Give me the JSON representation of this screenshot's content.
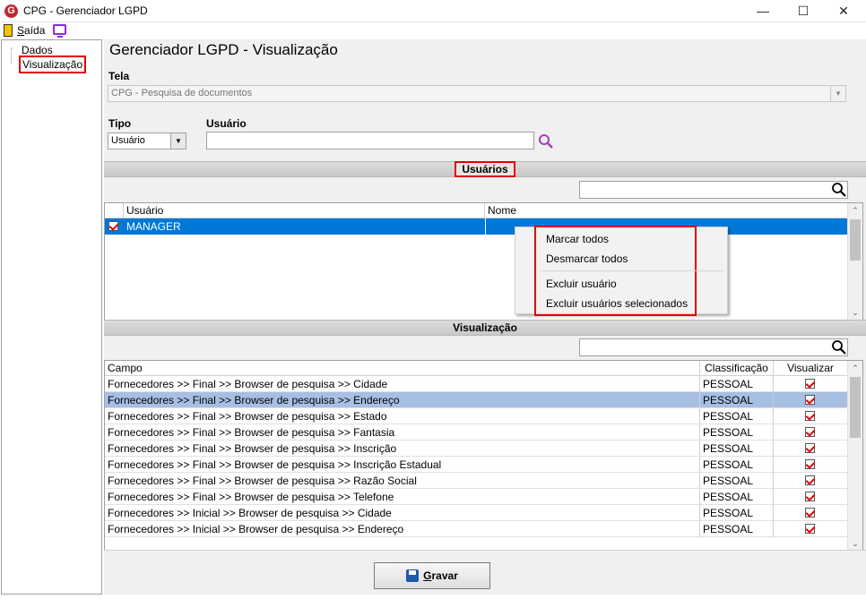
{
  "window": {
    "title": "CPG - Gerenciador LGPD",
    "logo": "G"
  },
  "menu": {
    "exit_first": "S",
    "exit_rest": "aída"
  },
  "sidebar": {
    "items": [
      "Dados",
      "Visualização"
    ]
  },
  "main": {
    "title": "Gerenciador LGPD - Visualização",
    "tela_label": "Tela",
    "tela_value": "CPG - Pesquisa de documentos",
    "tipo_label": "Tipo",
    "tipo_value": "Usuário",
    "usuario_label": "Usuário",
    "usuario_value": ""
  },
  "users_section": {
    "title": "Usuários",
    "search_value": "",
    "columns": [
      "Usuário",
      "Nome"
    ],
    "rows": [
      {
        "checked": true,
        "usuario": "MANAGER",
        "nome": ""
      }
    ]
  },
  "context_menu": {
    "items": [
      "Marcar todos",
      "Desmarcar todos",
      "Excluir usuário",
      "Excluir usuários selecionados"
    ]
  },
  "view_section": {
    "title": "Visualização",
    "search_value": "",
    "columns": [
      "Campo",
      "Classificação",
      "Visualizar"
    ],
    "rows": [
      {
        "campo": "Fornecedores >> Final >> Browser de pesquisa >> Cidade",
        "classificacao": "PESSOAL",
        "visualizar": true
      },
      {
        "campo": "Fornecedores >> Final >> Browser de pesquisa >> Endereço",
        "classificacao": "PESSOAL",
        "visualizar": true
      },
      {
        "campo": "Fornecedores >> Final >> Browser de pesquisa >> Estado",
        "classificacao": "PESSOAL",
        "visualizar": true
      },
      {
        "campo": "Fornecedores >> Final >> Browser de pesquisa >> Fantasia",
        "classificacao": "PESSOAL",
        "visualizar": true
      },
      {
        "campo": "Fornecedores >> Final >> Browser de pesquisa >> Inscrição",
        "classificacao": "PESSOAL",
        "visualizar": true
      },
      {
        "campo": "Fornecedores >> Final >> Browser de pesquisa >> Inscrição Estadual",
        "classificacao": "PESSOAL",
        "visualizar": true
      },
      {
        "campo": "Fornecedores >> Final >> Browser de pesquisa >> Razão Social",
        "classificacao": "PESSOAL",
        "visualizar": true
      },
      {
        "campo": "Fornecedores >> Final >> Browser de pesquisa >> Telefone",
        "classificacao": "PESSOAL",
        "visualizar": true
      },
      {
        "campo": "Fornecedores >> Inicial >> Browser de pesquisa >> Cidade",
        "classificacao": "PESSOAL",
        "visualizar": true
      },
      {
        "campo": "Fornecedores >> Inicial >> Browser de pesquisa >> Endereço",
        "classificacao": "PESSOAL",
        "visualizar": true
      }
    ]
  },
  "footer": {
    "save_first": "G",
    "save_rest": "ravar"
  },
  "colors": {
    "selection": "#0078d7",
    "row_highlight": "#a8bfe4",
    "annotation": "#e00000",
    "search_icon": "#a040c0"
  }
}
